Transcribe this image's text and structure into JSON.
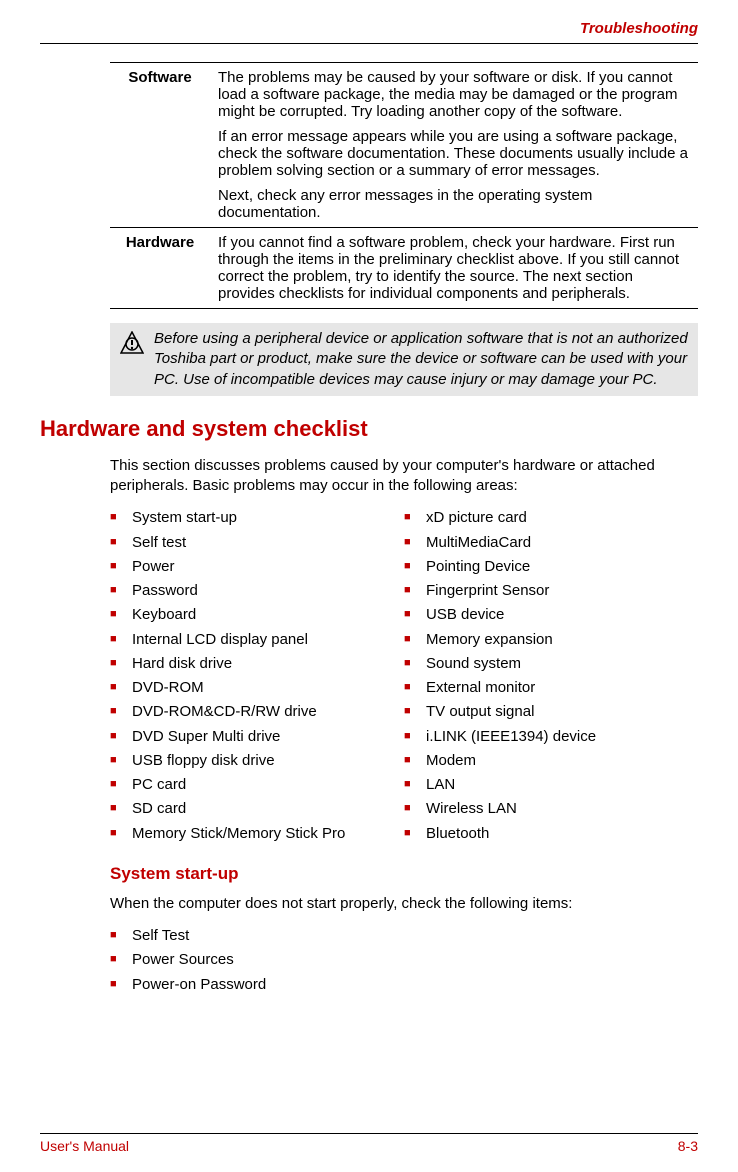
{
  "header": {
    "section": "Troubleshooting"
  },
  "table": {
    "rows": [
      {
        "term": "Software",
        "paras": [
          "The problems may be caused by your software or disk. If you cannot load a software package, the media may be damaged or the program might be corrupted. Try loading another copy of the software.",
          "If an error message appears while you are using a software package, check the software documentation. These documents usually include a problem solving section or a summary of error messages.",
          "Next, check any error messages in the operating system documentation."
        ]
      },
      {
        "term": "Hardware",
        "paras": [
          "If you cannot find a software problem, check your hardware. First run through the items in the preliminary checklist above. If you still cannot correct the problem, try to identify the source. The next section provides checklists for individual components and peripherals."
        ]
      }
    ]
  },
  "caution": "Before using a peripheral device or application software that is not an authorized Toshiba part or product, make sure the device or software can be used with your PC. Use of incompatible devices may cause injury or may damage your PC.",
  "checklist": {
    "heading": "Hardware and system checklist",
    "intro": "This section discusses problems caused by your computer's hardware or attached peripherals. Basic problems may occur in the following areas:",
    "col1": [
      "System start-up",
      "Self test",
      "Power",
      "Password",
      "Keyboard",
      "Internal LCD display panel",
      "Hard disk drive",
      "DVD-ROM",
      "DVD-ROM&CD-R/RW drive",
      "DVD Super Multi drive",
      "USB floppy disk drive",
      "PC card",
      "SD card",
      "Memory Stick/Memory Stick Pro"
    ],
    "col2": [
      "xD picture card",
      "MultiMediaCard",
      "Pointing Device",
      "Fingerprint Sensor",
      "USB device",
      "Memory expansion",
      "Sound system",
      "External monitor",
      "TV output signal",
      "i.LINK (IEEE1394) device",
      "Modem",
      "LAN",
      "Wireless LAN",
      "Bluetooth"
    ]
  },
  "startup": {
    "heading": "System start-up",
    "intro": "When the computer does not start properly, check the following items:",
    "items": [
      "Self Test",
      "Power Sources",
      "Power-on Password"
    ]
  },
  "footer": {
    "left": "User's Manual",
    "right": "8-3"
  }
}
